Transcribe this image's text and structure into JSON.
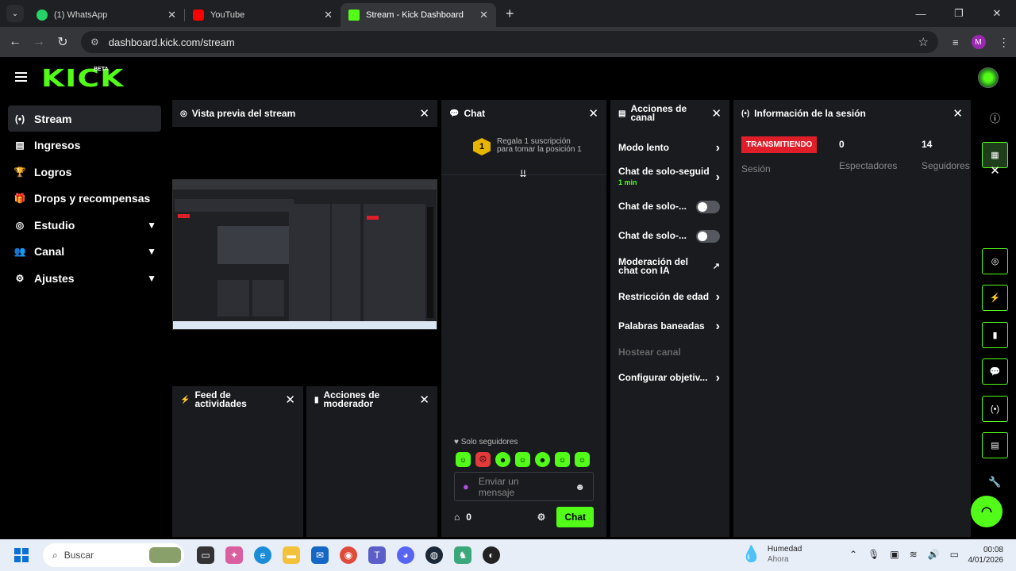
{
  "browser": {
    "tabs": [
      {
        "title": "(1) WhatsApp",
        "color": "#25d366"
      },
      {
        "title": "YouTube",
        "color": "#ff0000"
      },
      {
        "title": "Stream - Kick Dashboard",
        "color": "#53fc18"
      }
    ],
    "url": "dashboard.kick.com/stream",
    "profile_initial": "M"
  },
  "header": {
    "logo": "KICK",
    "beta": "BETA"
  },
  "sidebar": {
    "items": [
      {
        "label": "Stream",
        "icon": "broadcast-icon",
        "glyph": "(•)"
      },
      {
        "label": "Ingresos",
        "icon": "chart-icon",
        "glyph": "▤"
      },
      {
        "label": "Logros",
        "icon": "trophy-icon",
        "glyph": "🏆"
      },
      {
        "label": "Drops y recompensas",
        "icon": "gift-icon",
        "glyph": "🎁"
      },
      {
        "label": "Estudio",
        "icon": "camera-icon",
        "glyph": "◎"
      },
      {
        "label": "Canal",
        "icon": "users-icon",
        "glyph": "👥"
      },
      {
        "label": "Ajustes",
        "icon": "gear-icon",
        "glyph": "⚙"
      }
    ]
  },
  "panels": {
    "preview": {
      "title": "Vista previa del stream"
    },
    "feed": {
      "title": "Feed de actividades"
    },
    "mod": {
      "title": "Acciones de moderador"
    },
    "chat": {
      "title": "Chat",
      "gift_rank": "1",
      "gift_text": "Regala 1 suscripción para tomar la posición 1",
      "followers_only": "Solo seguidores",
      "placeholder": "Enviar un mensaje",
      "points": "0",
      "send_label": "Chat"
    },
    "actions": {
      "title": "Acciones de canal",
      "items": [
        {
          "label": "Modo lento"
        },
        {
          "label": "Chat de solo-seguid",
          "sub": "1 min"
        },
        {
          "label": "Chat de solo-..."
        },
        {
          "label": "Chat de solo-..."
        },
        {
          "label": "Moderación del chat con IA"
        },
        {
          "label": "Restricción de edad"
        },
        {
          "label": "Palabras baneadas"
        },
        {
          "label": "Hostear canal"
        },
        {
          "label": "Configurar objetiv..."
        }
      ]
    },
    "session": {
      "title": "Información de la sesión",
      "status": "TRANSMITIENDO",
      "status_label": "Sesión",
      "viewers": "0",
      "viewers_label": "Espectadores",
      "followers": "14",
      "followers_label": "Seguidores"
    }
  },
  "taskbar": {
    "search": "Buscar",
    "weather_title": "Humedad",
    "weather_sub": "Ahora",
    "time": "00:08",
    "date": "4/01/2026"
  }
}
